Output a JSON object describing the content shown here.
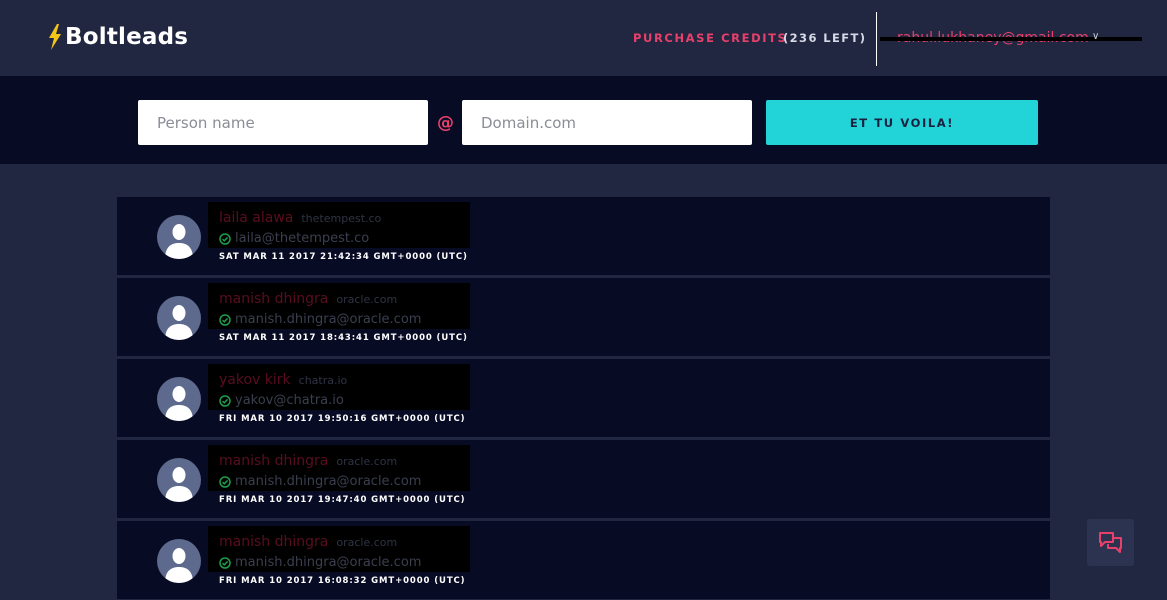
{
  "header": {
    "logo_text": "Boltleads",
    "purchase_label": "PURCHASE CREDITS",
    "credits_left": "(236 LEFT)",
    "user_email": "rahul.lukhaney@gmail.com",
    "caret": "∨"
  },
  "search": {
    "name_placeholder": "Person name",
    "at_symbol": "@",
    "domain_placeholder": "Domain.com",
    "button_label": "ET TU VOILA!"
  },
  "results": [
    {
      "name": "laila alawa",
      "domain": "thetempest.co",
      "email": "laila@thetempest.co",
      "timestamp": "SAT MAR 11 2017 21:42:34 GMT+0000 (UTC)"
    },
    {
      "name": "manish dhingra",
      "domain": "oracle.com",
      "email": "manish.dhingra@oracle.com",
      "timestamp": "SAT MAR 11 2017 18:43:41 GMT+0000 (UTC)"
    },
    {
      "name": "yakov kirk",
      "domain": "chatra.io",
      "email": "yakov@chatra.io",
      "timestamp": "FRI MAR 10 2017 19:50:16 GMT+0000 (UTC)"
    },
    {
      "name": "manish dhingra",
      "domain": "oracle.com",
      "email": "manish.dhingra@oracle.com",
      "timestamp": "FRI MAR 10 2017 19:47:40 GMT+0000 (UTC)"
    },
    {
      "name": "manish dhingra",
      "domain": "oracle.com",
      "email": "manish.dhingra@oracle.com",
      "timestamp": "FRI MAR 10 2017 16:08:32 GMT+0000 (UTC)"
    }
  ],
  "colors": {
    "background": "#222741",
    "search_band": "#080b24",
    "accent_pink": "#e8406b",
    "accent_cyan": "#22d3d7",
    "verified_green": "#1e9e4a"
  },
  "icons": {
    "logo": "lightning-bolt-icon",
    "avatar": "user-silhouette-icon",
    "verified": "check-circle-icon",
    "chat": "chat-bubbles-icon"
  }
}
